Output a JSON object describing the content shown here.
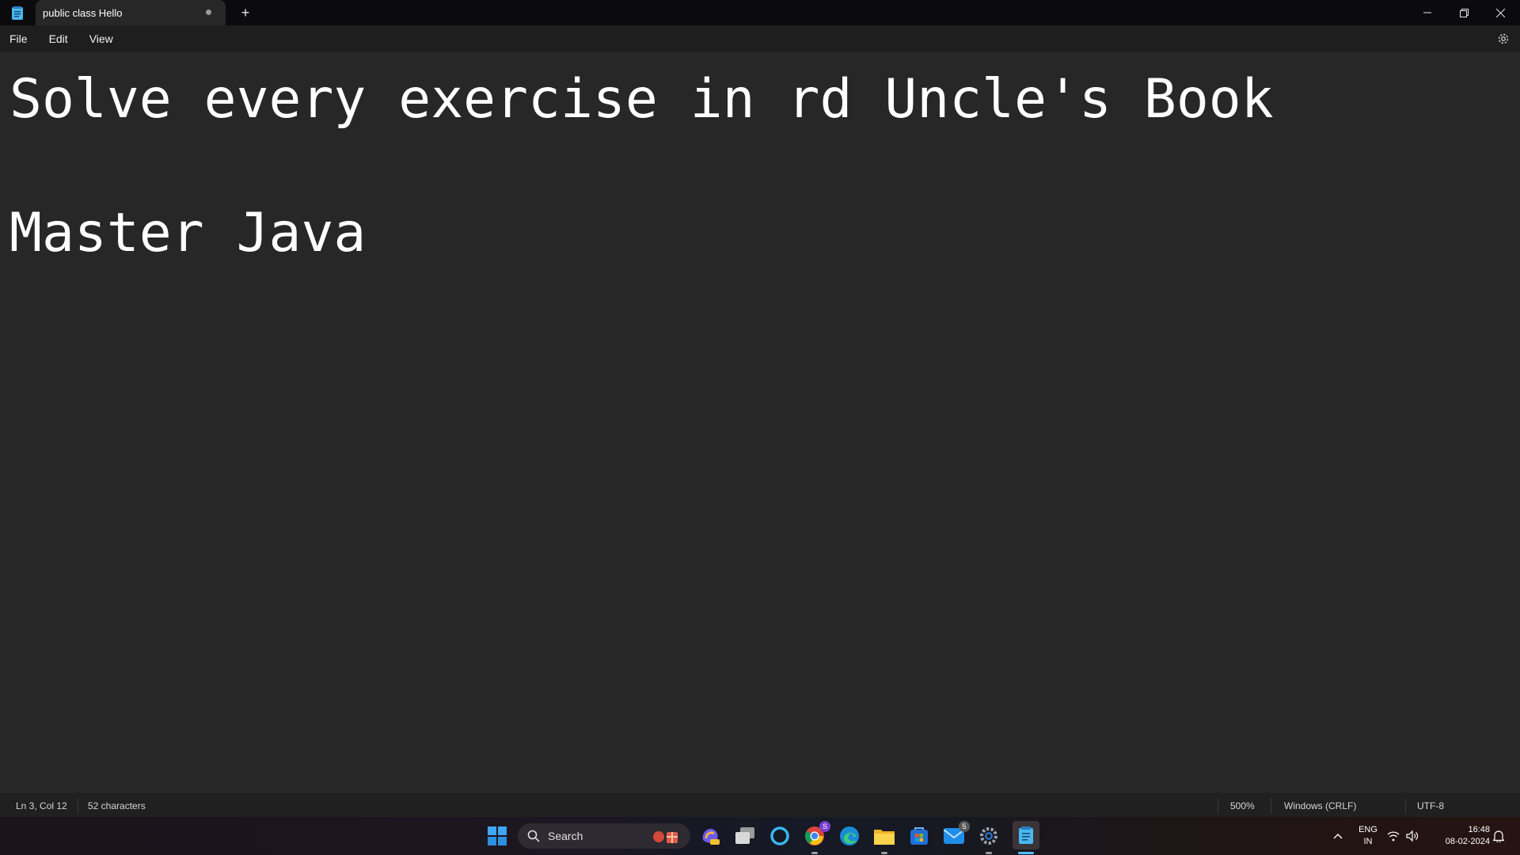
{
  "window": {
    "tab_title": "public class Hello",
    "new_tab_symbol": "+",
    "controls": [
      "minimize-icon",
      "restore-icon",
      "close-icon"
    ]
  },
  "menu": {
    "file": "File",
    "edit": "Edit",
    "view": "View"
  },
  "editor": {
    "lines": [
      "Solve every exercise in rd Uncle's Book",
      "",
      "Master Java"
    ]
  },
  "status": {
    "position": "Ln 3, Col 12",
    "characters": "52 characters",
    "zoom": "500%",
    "line_ending": "Windows (CRLF)",
    "encoding": "UTF-8"
  },
  "taskbar": {
    "search_label": "Search",
    "chrome_badge": "S",
    "mail_badge": "5",
    "language_line1": "ENG",
    "language_line2": "IN",
    "time": "16:48",
    "date": "08-02-2024"
  },
  "colors": {
    "editor_bg": "#272727",
    "titlebar_bg": "#0b0b0d",
    "menubar_bg": "#1e1e1e",
    "statusbar_bg": "#202020",
    "accent": "#4cc2ff"
  }
}
